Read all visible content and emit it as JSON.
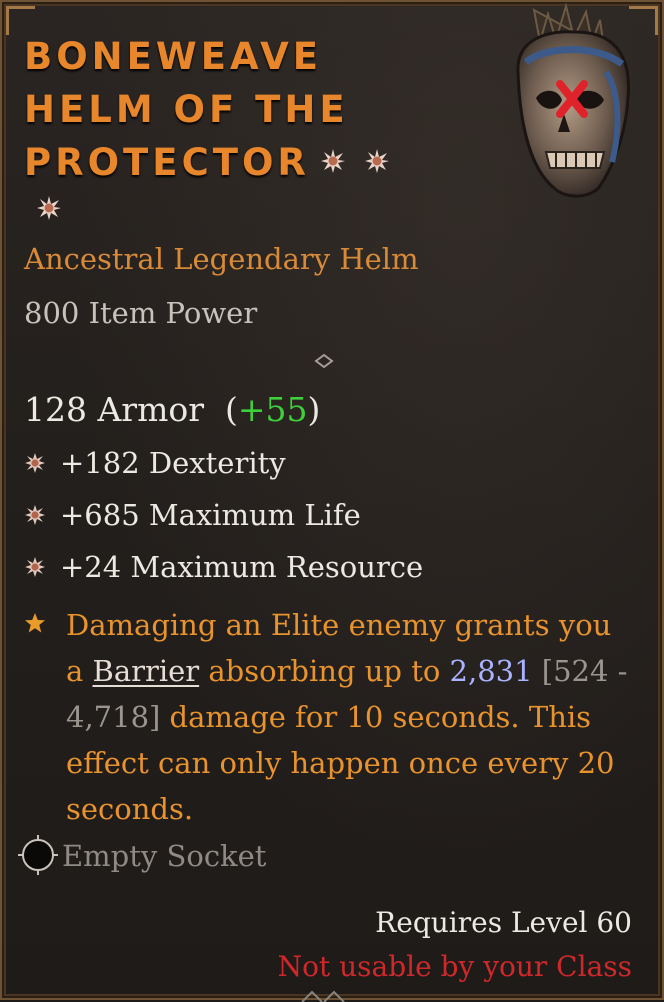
{
  "item": {
    "name_lines": [
      "BONEWEAVE",
      "HELM OF THE",
      "PROTECTOR"
    ],
    "subtitle": "Ancestral Legendary Helm",
    "item_power": "800 Item Power",
    "armor": {
      "value": "128 Armor",
      "bonus_open": "(",
      "bonus": "+55",
      "bonus_close": ")"
    },
    "stats": [
      "+182 Dexterity",
      "+685 Maximum Life",
      "+24 Maximum Resource"
    ],
    "legendary_affix": {
      "part1": "Damaging an Elite enemy grants you a ",
      "keyword": "Barrier",
      "part2": " absorbing up to ",
      "value": "2,831",
      "range": " [524 - 4,718]",
      "part3": " damage for 10 seconds. This effect can only happen once every 20 seconds."
    },
    "socket": "Empty Socket",
    "requirement": "Requires Level 60",
    "class_warning": "Not usable by your Class"
  },
  "icons": {
    "greater_affix": "greater-affix-star-icon",
    "stat_bullet": "affix-bullet-icon",
    "legendary": "legendary-star-icon",
    "socket": "empty-socket-icon",
    "helm": "skull-helm-icon",
    "unusable_mark": "red-x-icon"
  },
  "colors": {
    "title": "#e8862b",
    "legendary_text": "#e8932d",
    "bonus": "#3ed03a",
    "value_highlight": "#a9b3ff",
    "warning": "#d0282a"
  }
}
